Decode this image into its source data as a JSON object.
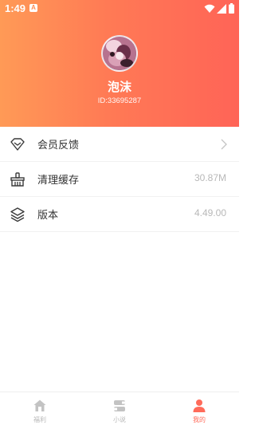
{
  "status_bar": {
    "time": "1:49",
    "notification_badge": "A"
  },
  "profile": {
    "username": "泡沫",
    "user_id": "ID:33695287"
  },
  "menu": {
    "items": [
      {
        "label": "会员反馈",
        "value": "",
        "icon": "diamond-icon",
        "has_chevron": true
      },
      {
        "label": "清理缓存",
        "value": "30.87M",
        "icon": "broom-icon",
        "has_chevron": false
      },
      {
        "label": "版本",
        "value": "4.49.00",
        "icon": "layers-icon",
        "has_chevron": false
      }
    ]
  },
  "tabbar": {
    "tabs": [
      {
        "label": "福利",
        "icon": "home-icon",
        "active": false
      },
      {
        "label": "小说",
        "icon": "book-icon",
        "active": false
      },
      {
        "label": "我的",
        "icon": "person-icon",
        "active": true
      }
    ]
  },
  "colors": {
    "header_gradient_start": "#ff9a56",
    "header_gradient_end": "#ff6457",
    "accent": "#ff6b5a",
    "text_primary": "#333333",
    "text_secondary": "#b8b8b8",
    "tab_inactive": "#b9b9b9"
  }
}
